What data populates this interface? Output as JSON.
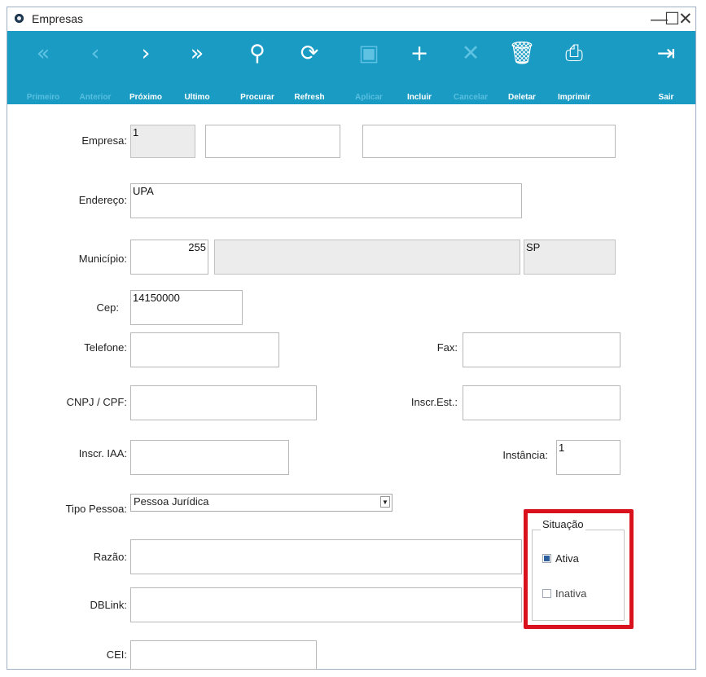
{
  "window": {
    "title": "Empresas",
    "controls": [
      "—",
      "☐",
      "✕"
    ]
  },
  "toolbar": {
    "buttons": [
      {
        "icon": "«",
        "label": "Primeiro",
        "enabled": false
      },
      {
        "icon": "‹",
        "label": "Anterior",
        "enabled": false
      },
      {
        "icon": "›",
        "label": "Próximo",
        "enabled": true
      },
      {
        "icon": "»",
        "label": "Ultimo",
        "enabled": true
      },
      {
        "icon": "⚲",
        "label": "Procurar",
        "enabled": true
      },
      {
        "icon": "⟳",
        "label": "Refresh",
        "enabled": true
      },
      {
        "icon": "▣",
        "label": "Aplicar",
        "enabled": false
      },
      {
        "icon": "+",
        "label": "Incluir",
        "enabled": true
      },
      {
        "icon": "✕",
        "label": "Cancelar",
        "enabled": false
      },
      {
        "icon": "🗑",
        "label": "Deletar",
        "enabled": true
      },
      {
        "icon": "⎙",
        "label": "Imprimir",
        "enabled": true
      },
      {
        "icon": "⇥",
        "label": "Sair",
        "enabled": true
      }
    ]
  },
  "form": {
    "empresa": {
      "label": "Empresa:",
      "code": "1",
      "name": "",
      "extra": ""
    },
    "endereco": {
      "label": "Endereço:",
      "value": "UPA"
    },
    "municipio": {
      "label": "Município:",
      "code": "255",
      "name": "",
      "uf": "SP"
    },
    "cep": {
      "label": "Cep:",
      "value": "14150000"
    },
    "telefone": {
      "label": "Telefone:",
      "value": ""
    },
    "fax": {
      "label": "Fax:",
      "value": ""
    },
    "cnpj": {
      "label": "CNPJ / CPF:",
      "value": ""
    },
    "inscr_est": {
      "label": "Inscr.Est.:",
      "value": ""
    },
    "inscr_iaa": {
      "label": "Inscr. IAA:",
      "value": ""
    },
    "instancia": {
      "label": "Instância:",
      "value": "1"
    },
    "tipo_pessoa": {
      "label": "Tipo Pessoa:",
      "value": "Pessoa Jurídica"
    },
    "razao": {
      "label": "Razão:",
      "value": ""
    },
    "dblink": {
      "label": "DBLink:",
      "value": ""
    },
    "cei": {
      "label": "CEI:",
      "value": ""
    },
    "situacao": {
      "title": "Situação",
      "options": [
        {
          "label": "Ativa",
          "checked": true
        },
        {
          "label": "Inativa",
          "checked": false
        }
      ]
    }
  },
  "colors": {
    "toolbar": "#1a9bc4",
    "highlight": "#d9111c"
  }
}
